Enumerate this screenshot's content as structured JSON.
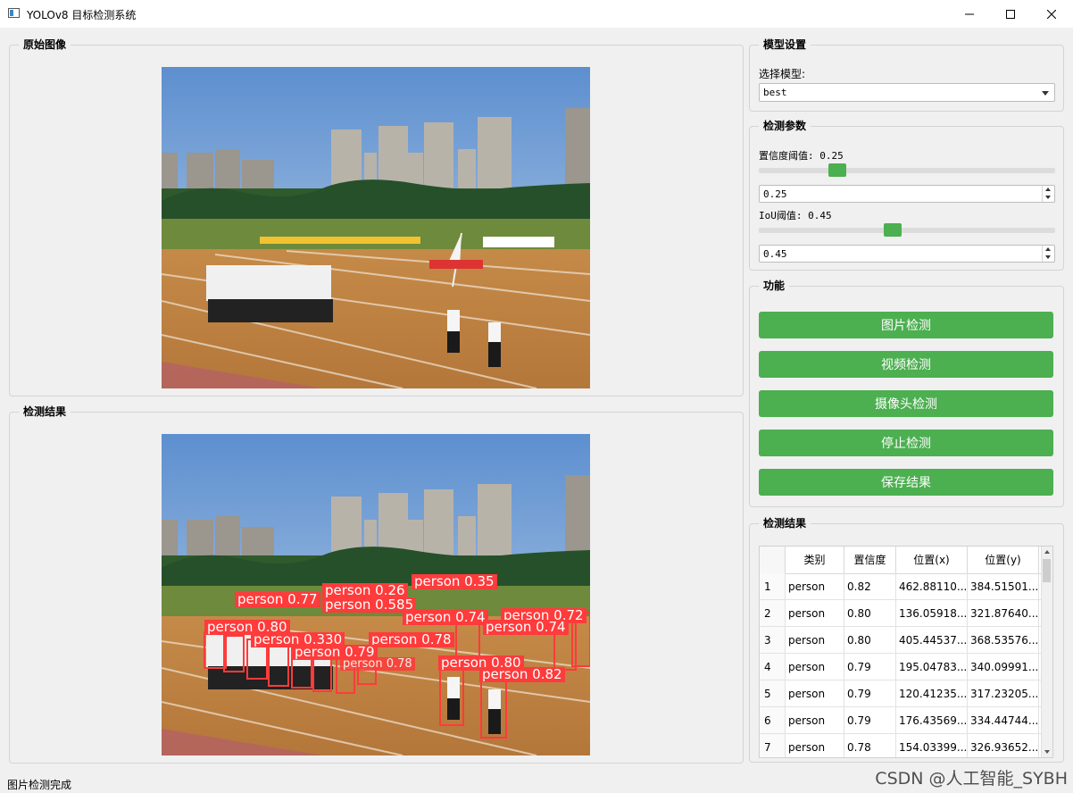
{
  "window": {
    "title": "YOLOv8 目标检测系统"
  },
  "panels": {
    "original_title": "原始图像",
    "result_title": "检测结果"
  },
  "model": {
    "group_title": "模型设置",
    "select_label": "选择模型:",
    "selected": "best"
  },
  "params": {
    "group_title": "检测参数",
    "conf_label": "置信度阈值: 0.25",
    "conf_value": "0.25",
    "conf_fraction": 0.25,
    "iou_label": "IoU阈值: 0.45",
    "iou_value": "0.45",
    "iou_fraction": 0.45
  },
  "functions": {
    "group_title": "功能",
    "image_detect": "图片检测",
    "video_detect": "视频检测",
    "camera_detect": "摄像头检测",
    "stop_detect": "停止检测",
    "save_result": "保存结果"
  },
  "results": {
    "group_title": "检测结果",
    "columns": [
      "类别",
      "置信度",
      "位置(x)",
      "位置(y)"
    ],
    "rows": [
      {
        "idx": "1",
        "cls": "person",
        "conf": "0.82",
        "x": "462.88110...",
        "y": "384.51501..."
      },
      {
        "idx": "2",
        "cls": "person",
        "conf": "0.80",
        "x": "136.05918...",
        "y": "321.87640..."
      },
      {
        "idx": "3",
        "cls": "person",
        "conf": "0.80",
        "x": "405.44537...",
        "y": "368.53576..."
      },
      {
        "idx": "4",
        "cls": "person",
        "conf": "0.79",
        "x": "195.04783...",
        "y": "340.09991..."
      },
      {
        "idx": "5",
        "cls": "person",
        "conf": "0.79",
        "x": "120.41235...",
        "y": "317.23205..."
      },
      {
        "idx": "6",
        "cls": "person",
        "conf": "0.79",
        "x": "176.43569...",
        "y": "334.44744..."
      },
      {
        "idx": "7",
        "cls": "person",
        "conf": "0.78",
        "x": "154.03399...",
        "y": "326.93652..."
      }
    ]
  },
  "detection_labels": [
    "person 0.35",
    "person 0.26",
    "person 0.585",
    "person 0.74",
    "person 0.72",
    "person 0.77",
    "person 0.80",
    "person 0.330",
    "person 0.78",
    "person 0.74",
    "person 0.79",
    "person 0.78",
    "person 0.80",
    "person 0.82"
  ],
  "status_text": "图片检测完成",
  "watermark": "CSDN @人工智能_SYBH",
  "colors": {
    "accent": "#4caf50",
    "detection_box": "#ff3b3b"
  }
}
